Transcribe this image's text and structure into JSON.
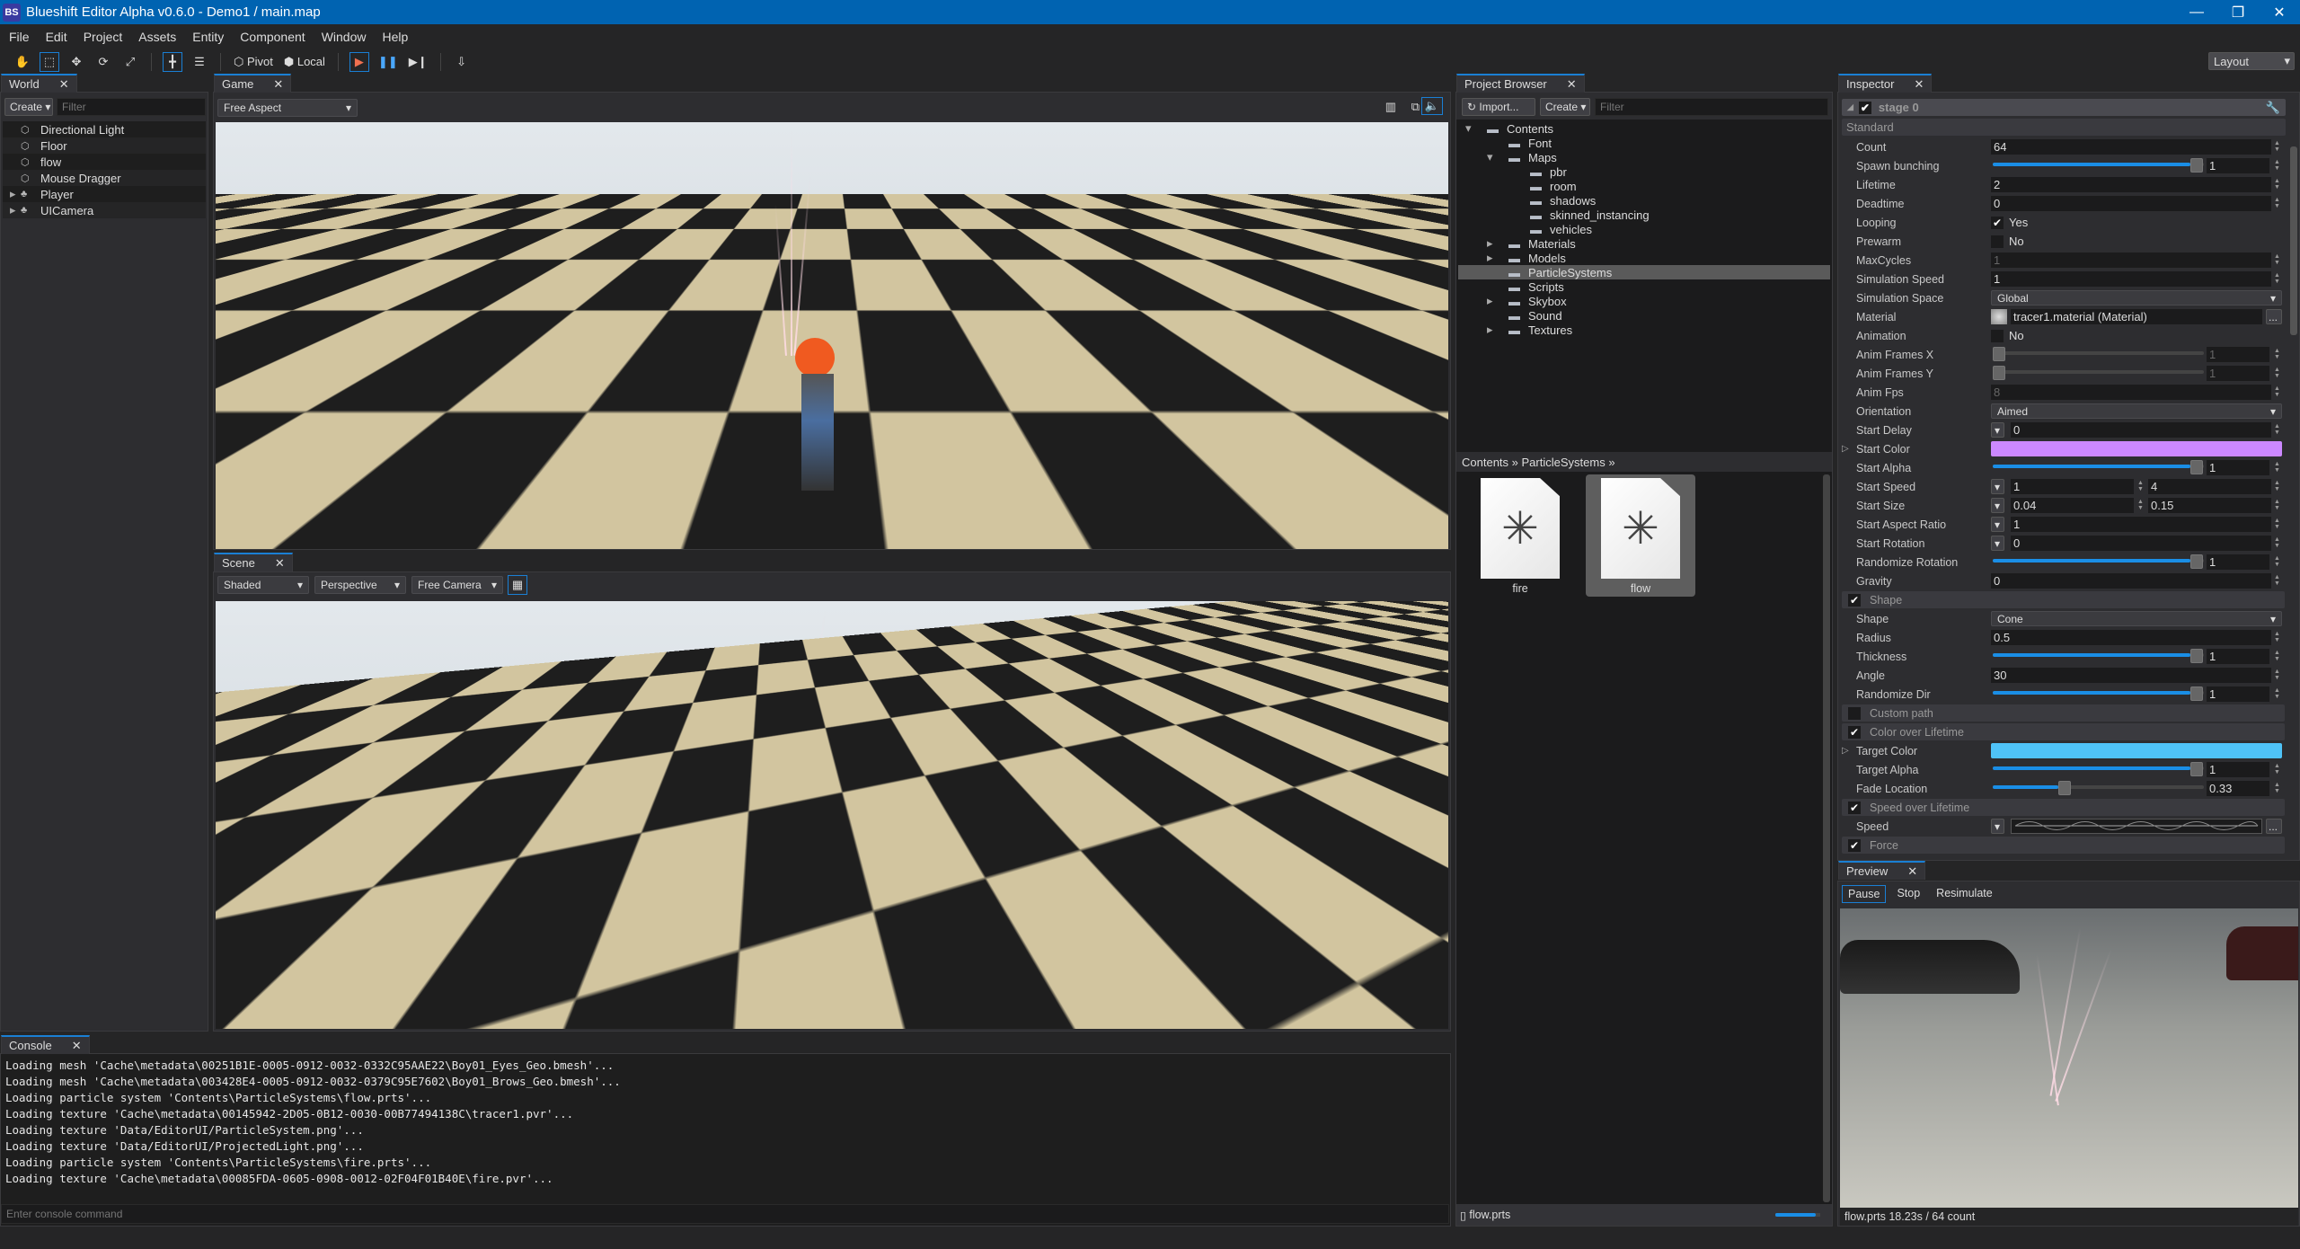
{
  "window": {
    "title": "Blueshift Editor Alpha v0.6.0 - Demo1 / main.map",
    "logo": "BS",
    "minimize": "—",
    "restore": "❐",
    "close": "✕"
  },
  "menu": [
    "File",
    "Edit",
    "Project",
    "Assets",
    "Entity",
    "Component",
    "Window",
    "Help"
  ],
  "toolbar": {
    "pivot": "Pivot",
    "local": "Local",
    "layout": "Layout",
    "icons": [
      "hand-icon",
      "rect-select-icon",
      "move-icon",
      "rotate-icon",
      "scale-icon",
      "snap-icon",
      "align-icon",
      "play-icon",
      "pause-icon",
      "step-icon",
      "build-icon"
    ]
  },
  "world": {
    "tab": "World",
    "create": "Create",
    "filter_placeholder": "Filter",
    "items": [
      {
        "label": "Directional Light",
        "icon": "entity-icon",
        "expandable": false
      },
      {
        "label": "Floor",
        "icon": "entity-icon",
        "expandable": false
      },
      {
        "label": "flow",
        "icon": "entity-icon",
        "expandable": false
      },
      {
        "label": "Mouse Dragger",
        "icon": "entity-icon",
        "expandable": false
      },
      {
        "label": "Player",
        "icon": "hierarchy-icon",
        "expandable": true
      },
      {
        "label": "UICamera",
        "icon": "hierarchy-icon",
        "expandable": true
      }
    ]
  },
  "game": {
    "tab": "Game",
    "aspect": "Free Aspect",
    "icons": [
      "stats-icon",
      "maximize-icon",
      "sound-icon"
    ]
  },
  "scene": {
    "tab": "Scene",
    "shading": "Shaded",
    "projection": "Perspective",
    "camera": "Free Camera",
    "grid_icon": "grid-icon"
  },
  "console": {
    "tab": "Console",
    "input_placeholder": "Enter console command",
    "lines": [
      "Loading mesh 'Cache\\metadata\\00251B1E-0005-0912-0032-0332C95AAE22\\Boy01_Eyes_Geo.bmesh'...",
      "Loading mesh 'Cache\\metadata\\003428E4-0005-0912-0032-0379C95E7602\\Boy01_Brows_Geo.bmesh'...",
      "Loading particle system 'Contents\\ParticleSystems\\flow.prts'...",
      "Loading texture 'Cache\\metadata\\00145942-2D05-0B12-0030-00B77494138C\\tracer1.pvr'...",
      "Loading texture 'Data/EditorUI/ParticleSystem.png'...",
      "Loading texture 'Data/EditorUI/ProjectedLight.png'...",
      "Loading particle system 'Contents\\ParticleSystems\\fire.prts'...",
      "Loading texture 'Cache\\metadata\\00085FDA-0605-0908-0012-02F04F01B40E\\fire.pvr'..."
    ]
  },
  "project": {
    "tab": "Project Browser",
    "import": "Import...",
    "create": "Create",
    "filter_placeholder": "Filter",
    "tree": [
      {
        "label": "Contents",
        "depth": 0,
        "arrow": "open"
      },
      {
        "label": "Font",
        "depth": 1,
        "arrow": ""
      },
      {
        "label": "Maps",
        "depth": 1,
        "arrow": "open"
      },
      {
        "label": "pbr",
        "depth": 2,
        "arrow": ""
      },
      {
        "label": "room",
        "depth": 2,
        "arrow": ""
      },
      {
        "label": "shadows",
        "depth": 2,
        "arrow": ""
      },
      {
        "label": "skinned_instancing",
        "depth": 2,
        "arrow": ""
      },
      {
        "label": "vehicles",
        "depth": 2,
        "arrow": ""
      },
      {
        "label": "Materials",
        "depth": 1,
        "arrow": "closed"
      },
      {
        "label": "Models",
        "depth": 1,
        "arrow": "closed"
      },
      {
        "label": "ParticleSystems",
        "depth": 1,
        "arrow": "",
        "selected": true
      },
      {
        "label": "Scripts",
        "depth": 1,
        "arrow": ""
      },
      {
        "label": "Skybox",
        "depth": 1,
        "arrow": "closed"
      },
      {
        "label": "Sound",
        "depth": 1,
        "arrow": ""
      },
      {
        "label": "Textures",
        "depth": 1,
        "arrow": "closed"
      }
    ],
    "breadcrumb": [
      "Contents",
      "ParticleSystems"
    ],
    "assets": [
      {
        "label": "fire",
        "selected": false
      },
      {
        "label": "flow",
        "selected": true
      }
    ],
    "status_file": "flow.prts",
    "thumb_size": 0.9
  },
  "inspector": {
    "tab": "Inspector",
    "stage": "stage 0",
    "stage_enabled": true,
    "group": "Standard",
    "rows": [
      {
        "type": "number",
        "label": "Count",
        "value": "64"
      },
      {
        "type": "slider",
        "label": "Spawn bunching",
        "value": "1",
        "fraction": 1
      },
      {
        "type": "number",
        "label": "Lifetime",
        "value": "2"
      },
      {
        "type": "number",
        "label": "Deadtime",
        "value": "0"
      },
      {
        "type": "check",
        "label": "Looping",
        "checked": true,
        "value": "Yes"
      },
      {
        "type": "check",
        "label": "Prewarm",
        "checked": false,
        "value": "No"
      },
      {
        "type": "number",
        "label": "MaxCycles",
        "value": "1",
        "disabled": true
      },
      {
        "type": "number",
        "label": "Simulation Speed",
        "value": "1"
      },
      {
        "type": "dropdown",
        "label": "Simulation Space",
        "value": "Global"
      },
      {
        "type": "material",
        "label": "Material",
        "value": "tracer1.material (Material)"
      },
      {
        "type": "check",
        "label": "Animation",
        "checked": false,
        "value": "No"
      },
      {
        "type": "slider",
        "label": "Anim Frames X",
        "value": "1",
        "fraction": 0,
        "disabled": true
      },
      {
        "type": "slider",
        "label": "Anim Frames Y",
        "value": "1",
        "fraction": 0,
        "disabled": true
      },
      {
        "type": "number",
        "label": "Anim Fps",
        "value": "8",
        "disabled": true
      },
      {
        "type": "dropdown",
        "label": "Orientation",
        "value": "Aimed"
      },
      {
        "type": "mode",
        "label": "Start Delay",
        "value": "0"
      },
      {
        "type": "color",
        "label": "Start Color",
        "color": "#cc88ff"
      },
      {
        "type": "slider",
        "label": "Start Alpha",
        "value": "1",
        "fraction": 1
      },
      {
        "type": "range",
        "label": "Start Speed",
        "value": "1",
        "value2": "4"
      },
      {
        "type": "range",
        "label": "Start Size",
        "value": "0.04",
        "value2": "0.15"
      },
      {
        "type": "mode",
        "label": "Start Aspect Ratio",
        "value": "1"
      },
      {
        "type": "mode",
        "label": "Start Rotation",
        "value": "0"
      },
      {
        "type": "slider",
        "label": "Randomize Rotation",
        "value": "1",
        "fraction": 1
      },
      {
        "type": "number",
        "label": "Gravity",
        "value": "0"
      },
      {
        "type": "section",
        "label": "Shape",
        "checked": true
      },
      {
        "type": "dropdown",
        "label": "Shape",
        "value": "Cone"
      },
      {
        "type": "number",
        "label": "Radius",
        "value": "0.5"
      },
      {
        "type": "slider",
        "label": "Thickness",
        "value": "1",
        "fraction": 1
      },
      {
        "type": "number",
        "label": "Angle",
        "value": "30"
      },
      {
        "type": "slider",
        "label": "Randomize Dir",
        "value": "1",
        "fraction": 1
      },
      {
        "type": "section",
        "label": "Custom path",
        "checked": false
      },
      {
        "type": "section",
        "label": "Color over Lifetime",
        "checked": true
      },
      {
        "type": "color",
        "label": "Target Color",
        "color": "#4fc3f7"
      },
      {
        "type": "slider",
        "label": "Target Alpha",
        "value": "1",
        "fraction": 1
      },
      {
        "type": "slider",
        "label": "Fade Location",
        "value": "0.33",
        "fraction": 0.33
      },
      {
        "type": "section",
        "label": "Speed over Lifetime",
        "checked": true
      },
      {
        "type": "curve",
        "label": "Speed"
      },
      {
        "type": "section",
        "label": "Force",
        "checked": true
      }
    ]
  },
  "preview": {
    "tab": "Preview",
    "buttons": [
      "Pause",
      "Stop",
      "Resimulate"
    ],
    "active": "Pause",
    "status": "flow.prts 18.23s / 64 count"
  }
}
